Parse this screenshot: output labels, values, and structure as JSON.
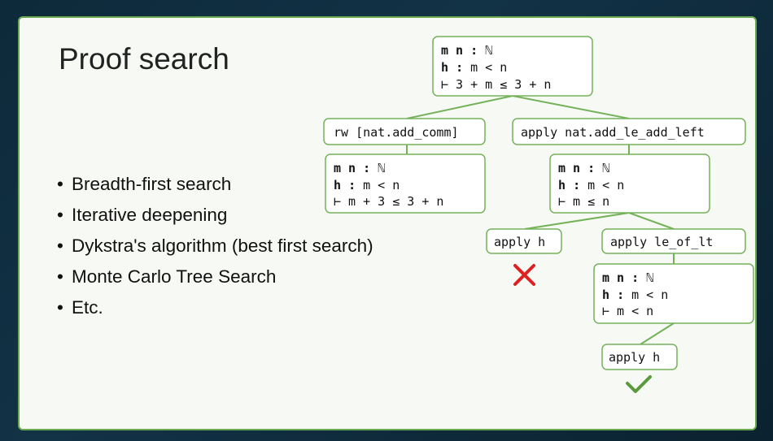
{
  "slide": {
    "title": "Proof search",
    "bullets": [
      "Breadth-first search",
      "Iterative deepening",
      "Dykstra's algorithm (best first search)",
      "Monte Carlo Tree Search",
      "Etc."
    ]
  },
  "tree": {
    "root_goal": {
      "vars_names": "m n",
      "vars_type": "ℕ",
      "hyp_name": "h",
      "hyp_stmt": "m < n",
      "target": "⊢ 3 + m ≤ 3 + n"
    },
    "tactic_rw": "rw [nat.add_comm]",
    "tactic_apply_add": "apply nat.add_le_add_left",
    "goal_rw": {
      "vars_names": "m n",
      "vars_type": "ℕ",
      "hyp_name": "h",
      "hyp_stmt": "m < n",
      "target": "⊢ m + 3 ≤ 3 + n"
    },
    "goal_apply_add": {
      "vars_names": "m n",
      "vars_type": "ℕ",
      "hyp_name": "h",
      "hyp_stmt": "m < n",
      "target": "⊢ m ≤ n"
    },
    "tactic_apply_h_fail": "apply h",
    "tactic_apply_le_of_lt": "apply le_of_lt",
    "goal_le_of_lt": {
      "vars_names": "m n",
      "vars_type": "ℕ",
      "hyp_name": "h",
      "hyp_stmt": "m < n",
      "target": "⊢ m < n"
    },
    "tactic_apply_h_success": "apply h",
    "fail_icon": "cross-icon",
    "success_icon": "checkmark-icon",
    "colors": {
      "border": "#74b25a",
      "fail": "#e02020",
      "success": "#5a9a3a"
    }
  }
}
